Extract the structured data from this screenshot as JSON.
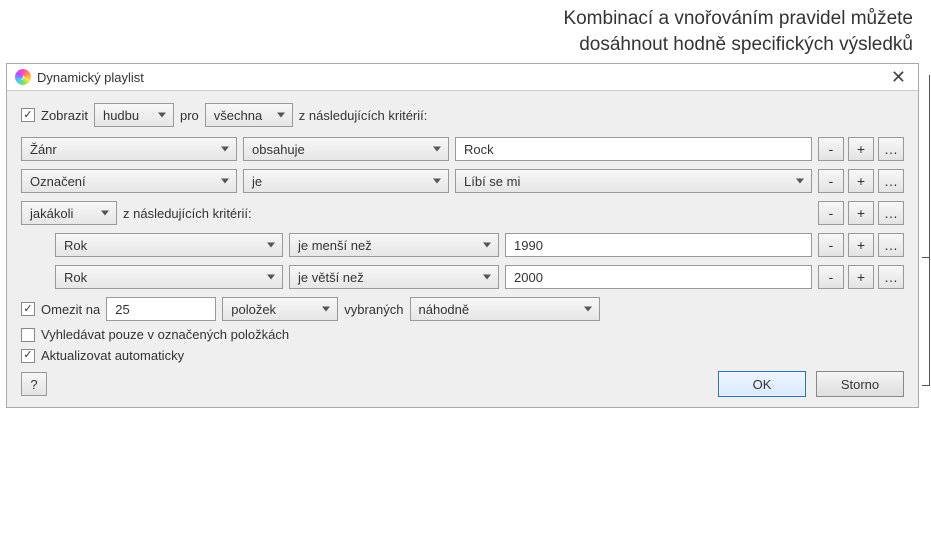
{
  "annotation": {
    "line1": "Kombinací a vnořováním pravidel můžete",
    "line2": "dosáhnout hodně specifických výsledků"
  },
  "window": {
    "title": "Dynamický playlist"
  },
  "header": {
    "show_label": "Zobrazit",
    "media_type": "hudbu",
    "for_label": "pro",
    "match": "všechna",
    "criteria_suffix": "z následujících kritérií:"
  },
  "rules": [
    {
      "field": "Žánr",
      "op": "obsahuje",
      "value": "Rock"
    },
    {
      "field": "Označení",
      "op": "je",
      "value": "Líbí se mi",
      "value_is_select": true
    }
  ],
  "subgroup": {
    "match": "jakákoli",
    "suffix": "z následujících kritérií:",
    "rules": [
      {
        "field": "Rok",
        "op": "je menší než",
        "value": "1990"
      },
      {
        "field": "Rok",
        "op": "je větší než",
        "value": "2000"
      }
    ]
  },
  "limit": {
    "label": "Omezit na",
    "count": "25",
    "unit": "položek",
    "selected_label": "vybraných",
    "method": "náhodně"
  },
  "options": {
    "search_checked_only": "Vyhledávat pouze v označených položkách",
    "live_update": "Aktualizovat automaticky"
  },
  "buttons": {
    "help": "?",
    "ok": "OK",
    "cancel": "Storno",
    "minus": "-",
    "plus": "+",
    "more": "…"
  }
}
